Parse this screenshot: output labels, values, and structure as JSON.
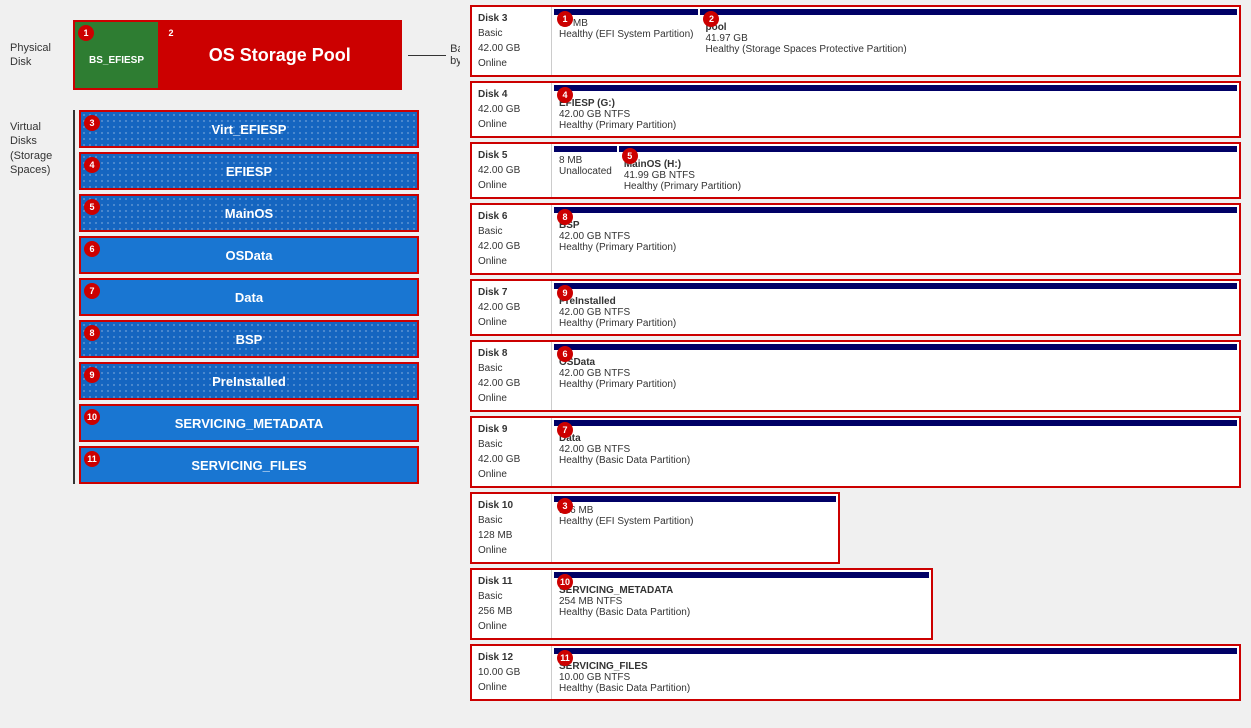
{
  "left": {
    "physical_disk_label": "Physical\nDisk",
    "backed_by_label": "Backed by",
    "virtual_disks_label": "Virtual\nDisks\n(Storage\nSpaces)",
    "bs_efiesp": "BS_EFIESP",
    "os_storage_pool": "OS Storage Pool",
    "badge_1": "1",
    "badge_2": "2",
    "virtual_disks": [
      {
        "id": "3",
        "label": "Virt_EFIESP",
        "style": "dotted"
      },
      {
        "id": "4",
        "label": "EFIESP",
        "style": "dotted"
      },
      {
        "id": "5",
        "label": "MainOS",
        "style": "dotted"
      },
      {
        "id": "6",
        "label": "OSData",
        "style": "solid"
      },
      {
        "id": "7",
        "label": "Data",
        "style": "solid"
      },
      {
        "id": "8",
        "label": "BSP",
        "style": "dotted"
      },
      {
        "id": "9",
        "label": "PreInstalled",
        "style": "dotted"
      },
      {
        "id": "10",
        "label": "SERVICING_METADATA",
        "style": "solid"
      },
      {
        "id": "11",
        "label": "SERVICING_FILES",
        "style": "solid"
      }
    ]
  },
  "right": {
    "disks": [
      {
        "name": "Disk 3",
        "type": "Basic",
        "size": "42.00 GB",
        "status": "Online",
        "partitions": [
          {
            "badge": "1",
            "name": "",
            "details": [
              "32 MB",
              "Healthy (EFI System Partition)"
            ]
          },
          {
            "badge": "2",
            "name": "pool",
            "details": [
              "41.97 GB",
              "Healthy (Storage Spaces Protective Partition)"
            ]
          }
        ]
      },
      {
        "name": "Disk 4",
        "type": "",
        "size": "42.00 GB",
        "status": "Online",
        "partitions": [
          {
            "badge": "4",
            "name": "EFIESP (G:)",
            "details": [
              "42.00 GB NTFS",
              "Healthy (Primary Partition)"
            ]
          }
        ]
      },
      {
        "name": "Disk 5",
        "type": "",
        "size": "42.00 GB",
        "status": "Online",
        "partitions": [
          {
            "badge": "",
            "name": "",
            "details": [
              "8 MB",
              "Unallocated"
            ]
          },
          {
            "badge": "5",
            "name": "MainOS (H:)",
            "details": [
              "41.99 GB NTFS",
              "Healthy (Primary Partition)"
            ]
          }
        ]
      },
      {
        "name": "Disk 6",
        "type": "Basic",
        "size": "42.00 GB",
        "status": "Online",
        "partitions": [
          {
            "badge": "8",
            "name": "BSP",
            "details": [
              "42.00 GB NTFS",
              "Healthy (Primary Partition)"
            ]
          }
        ]
      },
      {
        "name": "Disk 7",
        "type": "",
        "size": "42.00 GB",
        "status": "Online",
        "partitions": [
          {
            "badge": "9",
            "name": "PreInstalled",
            "details": [
              "42.00 GB NTFS",
              "Healthy (Primary Partition)"
            ]
          }
        ]
      },
      {
        "name": "Disk 8",
        "type": "Basic",
        "size": "42.00 GB",
        "status": "Online",
        "partitions": [
          {
            "badge": "6",
            "name": "OSData",
            "details": [
              "42.00 GB NTFS",
              "Healthy (Primary Partition)"
            ]
          }
        ]
      },
      {
        "name": "Disk 9",
        "type": "Basic",
        "size": "42.00 GB",
        "status": "Online",
        "partitions": [
          {
            "badge": "7",
            "name": "Data",
            "details": [
              "42.00 GB NTFS",
              "Healthy (Basic Data Partition)"
            ]
          }
        ]
      },
      {
        "name": "Disk 10",
        "type": "Basic",
        "size": "128 MB",
        "status": "Online",
        "partitions": [
          {
            "badge": "3",
            "name": "",
            "details": [
              "126 MB",
              "Healthy (EFI System Partition)"
            ]
          }
        ],
        "narrow": true
      },
      {
        "name": "Disk 11",
        "type": "Basic",
        "size": "256 MB",
        "status": "Online",
        "partitions": [
          {
            "badge": "10",
            "name": "SERVICING_METADATA",
            "details": [
              "254 MB NTFS",
              "Healthy (Basic Data Partition)"
            ]
          }
        ],
        "medium": true
      },
      {
        "name": "Disk 12",
        "type": "",
        "size": "10.00 GB",
        "status": "Online",
        "partitions": [
          {
            "badge": "11",
            "name": "SERVICING_FILES",
            "details": [
              "10.00 GB NTFS",
              "Healthy (Basic Data Partition)"
            ]
          }
        ]
      }
    ]
  }
}
